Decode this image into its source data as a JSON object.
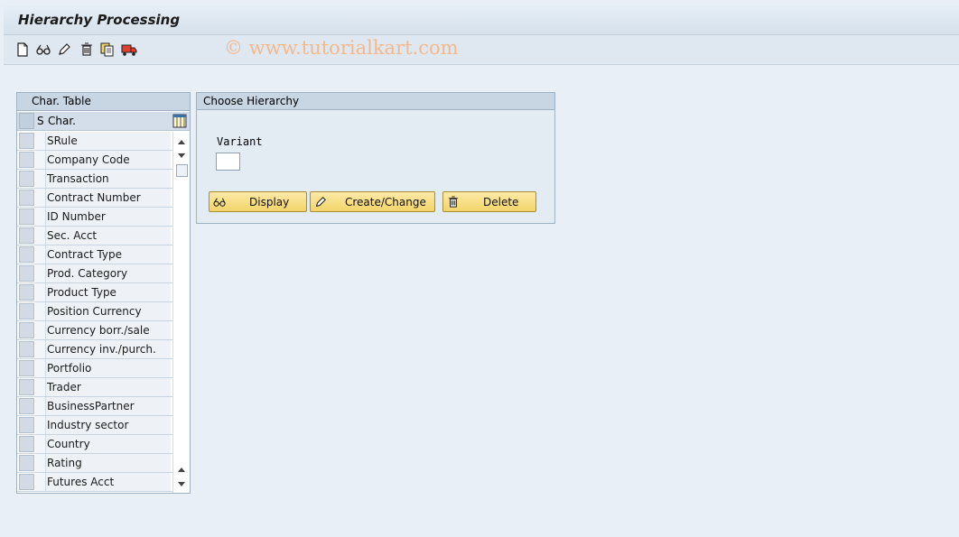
{
  "window": {
    "title": "Hierarchy Processing"
  },
  "toolbar": {
    "icons": [
      "new-document-icon",
      "display-glasses-icon",
      "edit-pencil-icon",
      "delete-trash-icon",
      "copy-icon",
      "transport-truck-icon"
    ]
  },
  "watermark": "© www.tutorialkart.com",
  "char_table": {
    "title": "Char. Table",
    "col_s": "S",
    "col_char": "Char.",
    "rows": [
      "SRule",
      "Company Code",
      "Transaction",
      "Contract Number",
      "ID Number",
      "Sec. Acct",
      "Contract Type",
      "Prod. Category",
      "Product Type",
      "Position Currency",
      "Currency borr./sale",
      "Currency inv./purch.",
      "Portfolio",
      "Trader",
      "BusinessPartner",
      "Industry sector",
      "Country",
      "Rating",
      "Futures Acct"
    ]
  },
  "hierarchy": {
    "title": "Choose Hierarchy",
    "variant_label": "Variant",
    "variant_value": "",
    "display_label": "Display",
    "create_label": "Create/Change",
    "delete_label": "Delete"
  },
  "colors": {
    "background": "#e8eff6",
    "panel_header": "#c8d6e4",
    "button": "#f4d56a",
    "watermark": "#f3b98d"
  }
}
